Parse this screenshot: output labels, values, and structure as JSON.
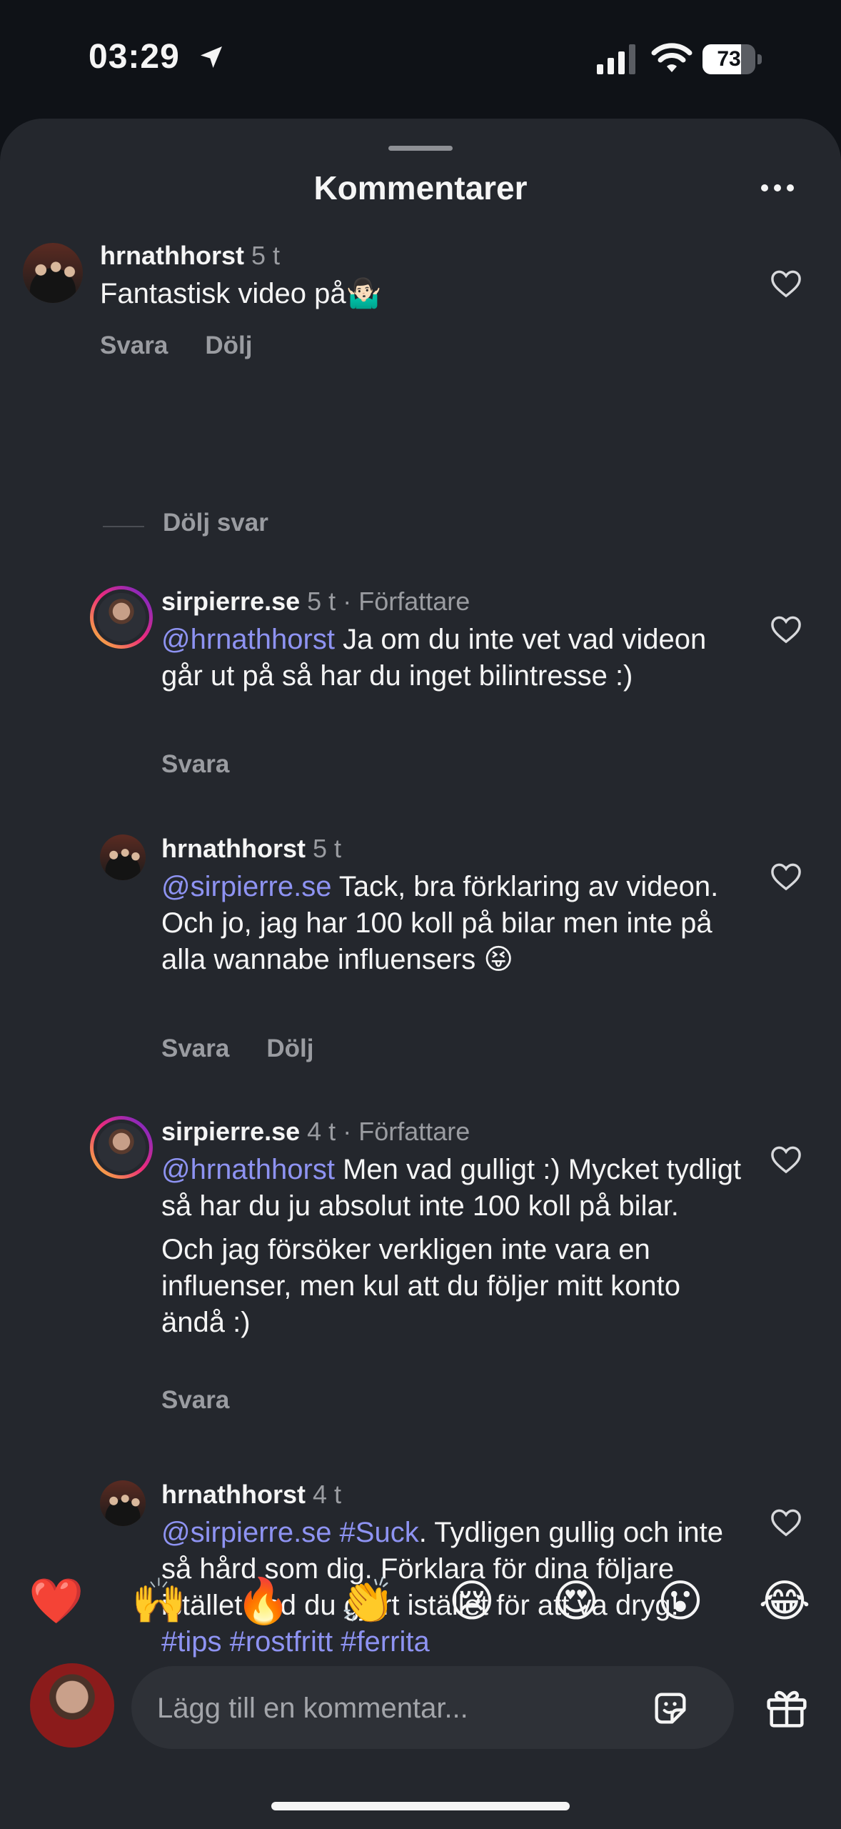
{
  "status_bar": {
    "time": "03:29",
    "battery": "73",
    "battery_level": 0.73
  },
  "sheet": {
    "title": "Kommentarer"
  },
  "comments": [
    {
      "user": "hrnathhorst",
      "time": "5 t",
      "author_label": "",
      "mention": "",
      "text": "Fantastisk video på🤷🏻‍♂️",
      "actions": [
        "Svara",
        "Dölj"
      ]
    },
    {
      "user": "sirpierre.se",
      "time": "5 t",
      "author_label": "Författare",
      "mention": "@hrnathhorst",
      "text": " Ja om du inte vet vad videon går ut på så har du inget bilintresse :)",
      "actions": [
        "Svara"
      ]
    },
    {
      "user": "hrnathhorst",
      "time": "5 t",
      "author_label": "",
      "mention": "@sirpierre.se",
      "text": " Tack, bra förklaring av videon. Och jo, jag har 100 koll på bilar men inte på alla wannabe influensers 😝",
      "actions": [
        "Svara",
        "Dölj"
      ]
    },
    {
      "user": "sirpierre.se",
      "time": "4 t",
      "author_label": "Författare",
      "mention": "@hrnathhorst",
      "text": " Men vad gulligt :) Mycket tydligt så har du ju absolut inte 100 koll på bilar.",
      "text2": "Och jag försöker verkligen inte vara en influenser, men kul att du följer mitt konto ändå :)",
      "actions": [
        "Svara"
      ]
    },
    {
      "user": "hrnathhorst",
      "time": "4 t",
      "author_label": "",
      "mention": "@sirpierre.se",
      "tag1": " #Suck",
      "text": ". Tydligen gullig och inte så hård som dig. Förklara för dina följare istället vad du gjort istället för att va dryg! ",
      "tags": "#tips #rostfritt #ferrita",
      "actions": []
    }
  ],
  "sep": "·",
  "hide_replies": "Dölj svar",
  "emoji_bar": [
    "❤️",
    "🙌",
    "🔥",
    "👏",
    "😢",
    "😍",
    "😮",
    "😂"
  ],
  "input": {
    "placeholder": "Lägg till en kommentar..."
  },
  "colors": {
    "mention": "#8e93f2",
    "sheet_bg": "#24272d",
    "page_bg": "#0f1217"
  }
}
